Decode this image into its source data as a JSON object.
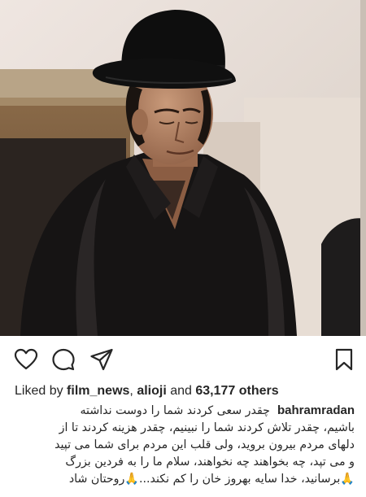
{
  "post": {
    "likes": {
      "prefix": "Liked by",
      "user1": "film_news",
      "sep": ",",
      "user2": "alioji",
      "and": "and",
      "count": "63,177 others"
    },
    "caption": {
      "username": "bahramradan",
      "line1": "چقدر سعی کردند شما را دوست نداشته",
      "line2": "باشیم، چقدر تلاش کردند شما را نبینیم، چقدر هزینه کردند تا از",
      "line3": "دلهای مردم بیرون بروید، ولی قلب این مردم برای شما می تپید",
      "line4": "و می تپد، چه بخواهند چه نخواهند، سلام ما را به فردین بزرگ",
      "line5": "🙏برسانید، خدا سایه بهروز خان را کم نکند...🙏روحتان شاد"
    }
  },
  "icons": {
    "like": "heart-icon",
    "comment": "comment-icon",
    "share": "share-icon",
    "save": "bookmark-icon"
  }
}
